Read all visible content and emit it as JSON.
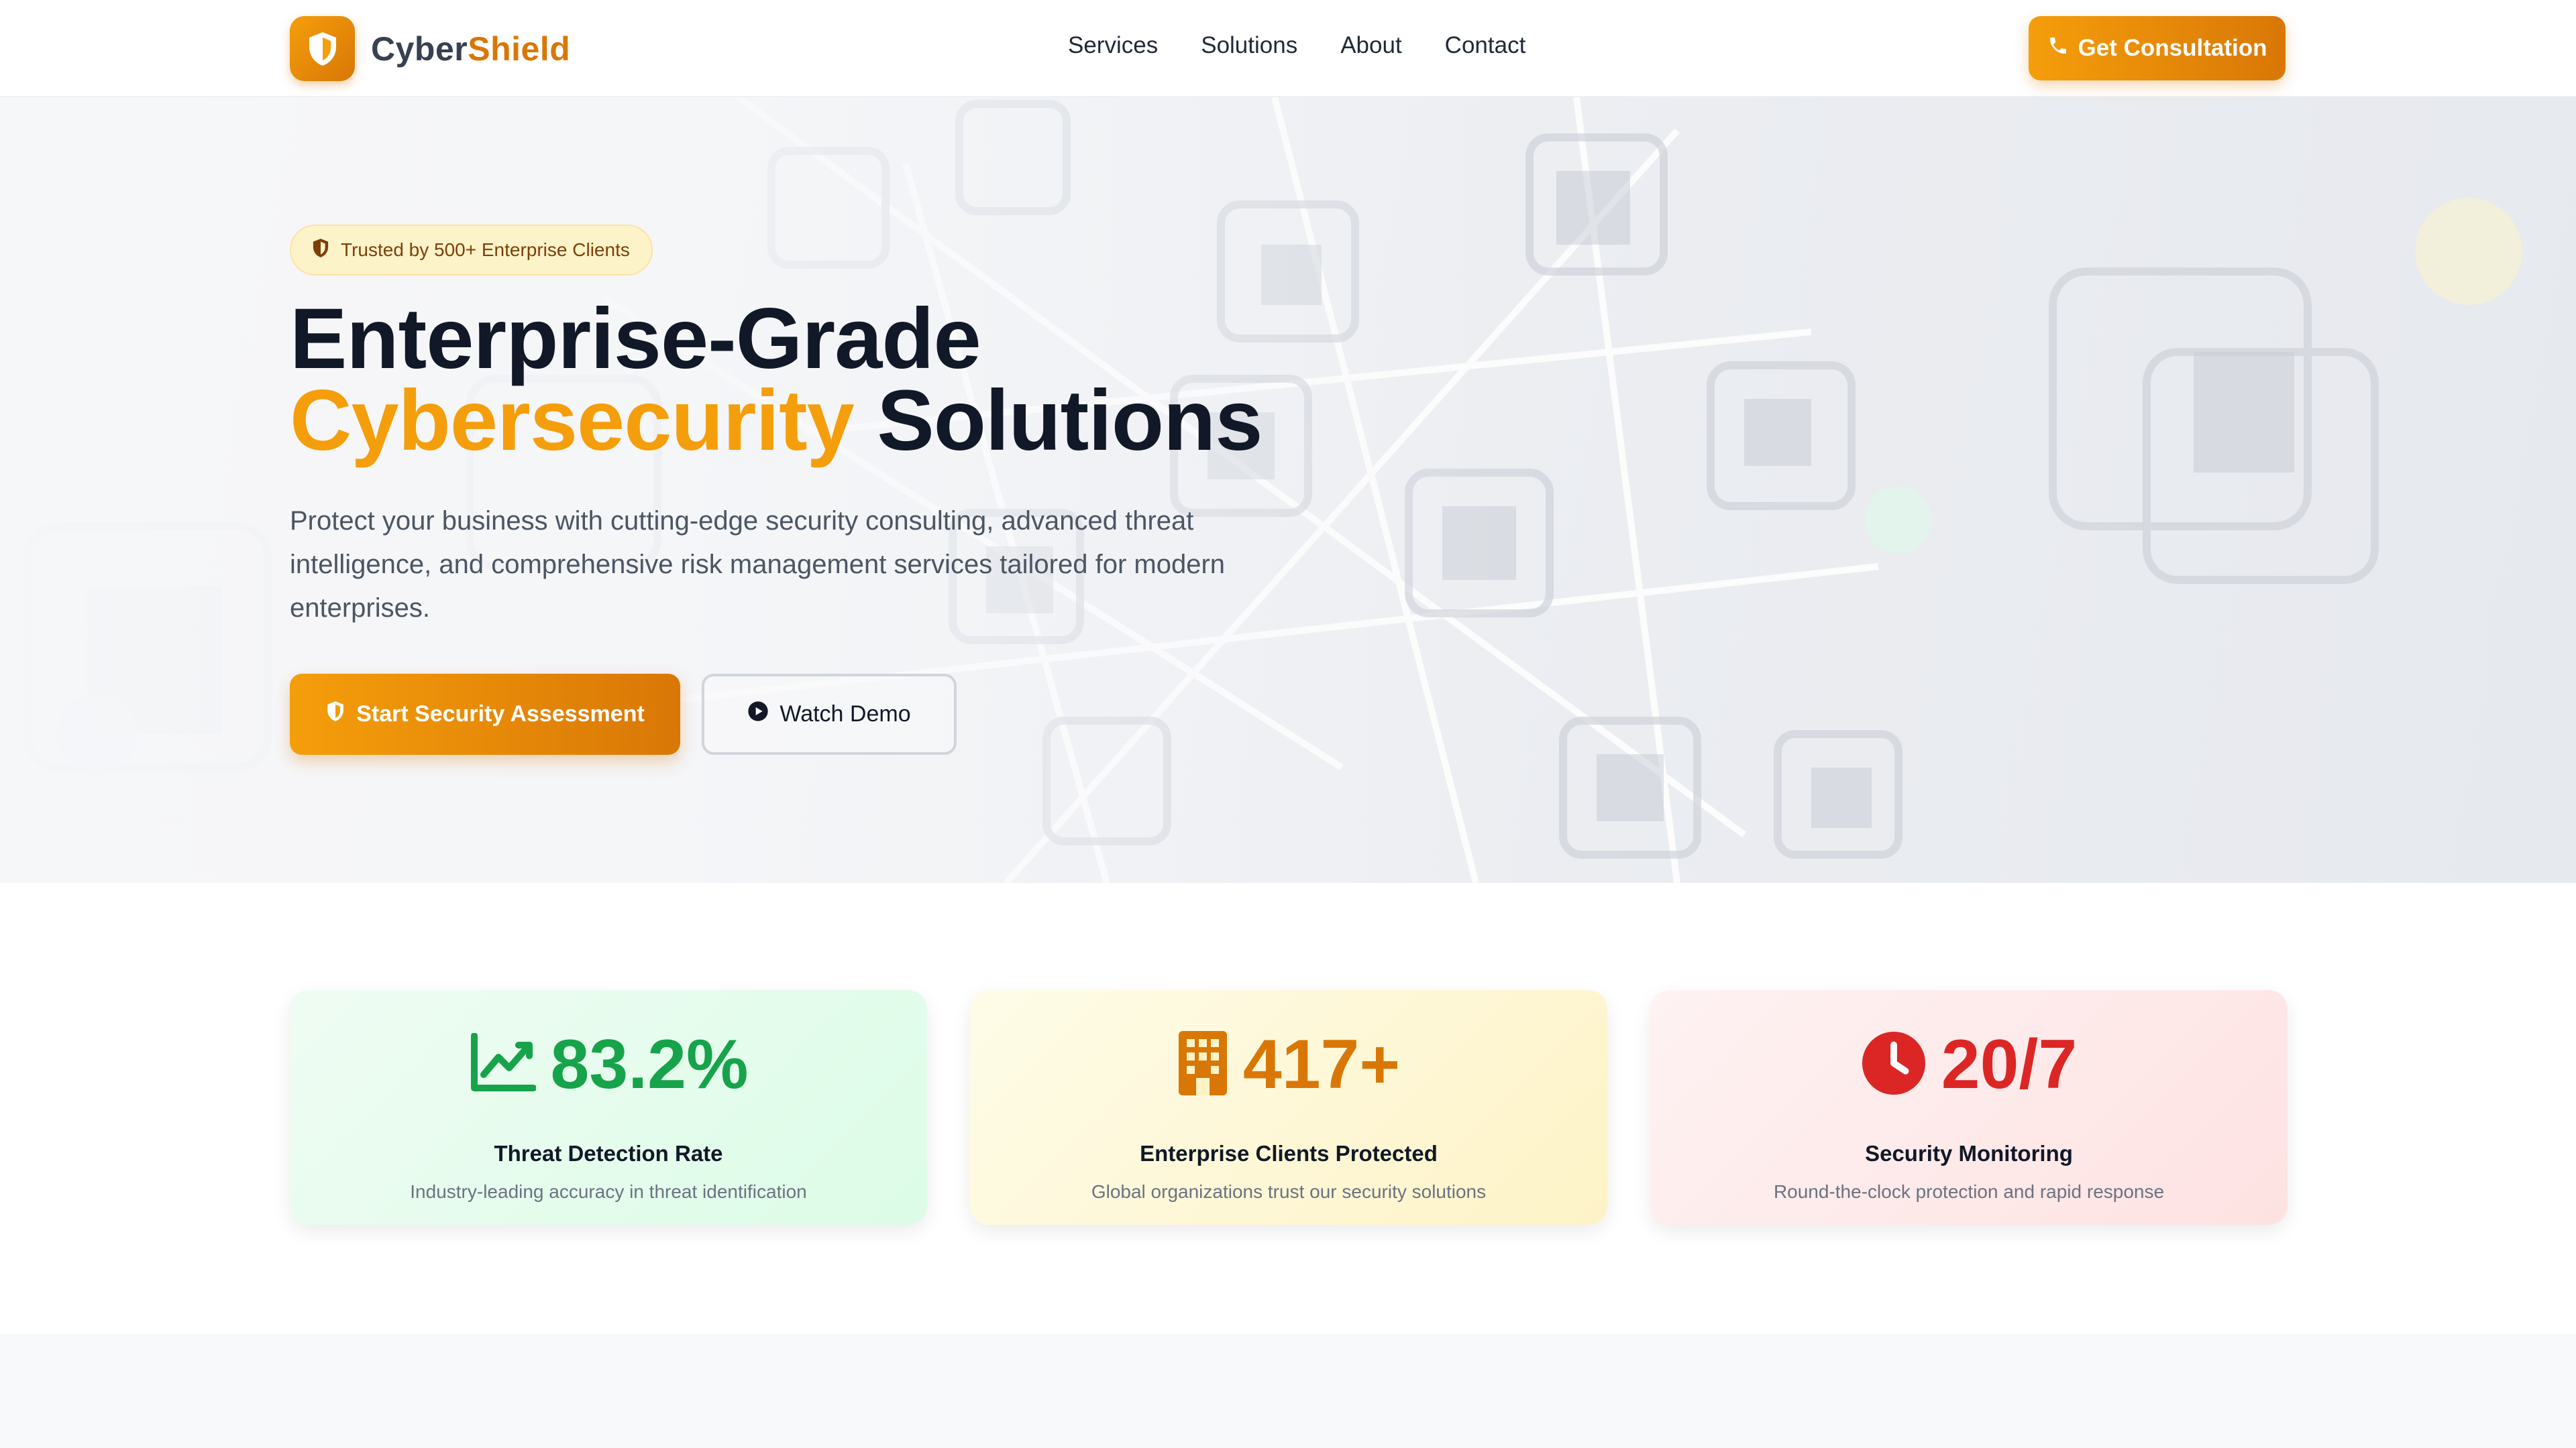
{
  "brand": {
    "name_part1": "Cyber",
    "name_part2": "Shield",
    "icon": "shield-icon"
  },
  "nav": {
    "links": [
      "Services",
      "Solutions",
      "About",
      "Contact"
    ],
    "cta_label": "Get Consultation",
    "cta_icon": "phone-icon"
  },
  "hero": {
    "badge": "Trusted by 500+ Enterprise Clients",
    "title_line1": "Enterprise-Grade",
    "title_accent": "Cybersecurity",
    "title_rest": " Solutions",
    "subtitle": "Protect your business with cutting-edge security consulting, advanced threat intelligence, and comprehensive risk management services tailored for modern enterprises.",
    "primary_cta": "Start Security Assessment",
    "secondary_cta": "Watch Demo"
  },
  "stats": [
    {
      "value": "83.2%",
      "label": "Threat Detection Rate",
      "desc": "Industry-leading accuracy in threat identification",
      "icon": "trend-chart-icon",
      "color": "#16a34a"
    },
    {
      "value": "417+",
      "label": "Enterprise Clients Protected",
      "desc": "Global organizations trust our security solutions",
      "icon": "building-icon",
      "color": "#d97706"
    },
    {
      "value": "20/7",
      "label": "Security Monitoring",
      "desc": "Round-the-clock protection and rapid response",
      "icon": "clock-icon",
      "color": "#dc2626"
    }
  ],
  "colors": {
    "accent": "#f59e0b",
    "accent_dark": "#d97706",
    "text": "#111827",
    "muted": "#4b5563"
  }
}
